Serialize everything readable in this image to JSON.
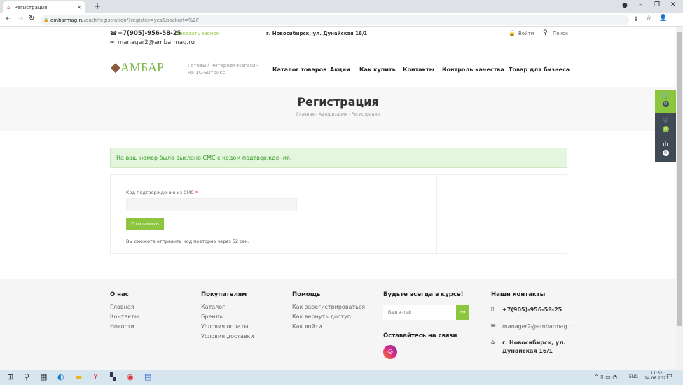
{
  "browser": {
    "tab_title": "Регистрация",
    "url_host": "ambarmag.ru",
    "url_path": "/auth/registration/?register=yes&backurl=%2F"
  },
  "topbar": {
    "phone": "+7(905)-956-58-25",
    "callback": "Заказать звонок",
    "email": "manager2@ambarmag.ru",
    "address": "г. Новосибирск, ул. Дунайская 16/1",
    "login": "Войти",
    "search": "Поиск"
  },
  "header": {
    "logo": "АМБАР",
    "slogan_1": "Готовый интернет-магазин",
    "slogan_2": "на 1С-Битрикс",
    "nav": [
      "Каталог товаров",
      "Акции",
      "Как купить",
      "Контакты",
      "Контроль качества",
      "Товар для бизнеса"
    ]
  },
  "page": {
    "title": "Регистрация",
    "breadcrumb": [
      "Главная",
      "Авторизация",
      "Регистрация"
    ],
    "alert": "На ваш номер было выслано СМС с кодом подтверждения.",
    "code_label": "Код подтверждения из СМС",
    "required_mark": "*",
    "code_value": "",
    "submit": "Отправить",
    "resend_note": "Вы сможете отправить код повторно через 52 сек."
  },
  "side": {
    "cart_count": "0",
    "favorites_count": "0",
    "compare_count": "0"
  },
  "footer": {
    "about": {
      "title": "О нас",
      "links": [
        "Главная",
        "Контакты",
        "Новости"
      ]
    },
    "buyers": {
      "title": "Покупателям",
      "links": [
        "Каталог",
        "Бренды",
        "Условия оплаты",
        "Условия доставки"
      ]
    },
    "help": {
      "title": "Помощь",
      "links": [
        "Как зарегистрироваться",
        "Как вернуть доступ",
        "Как войти"
      ]
    },
    "subscribe": {
      "title": "Будьте всегда в курсе!",
      "placeholder": "Ваш e-mail",
      "social_title": "Оставайтесь на связи"
    },
    "contacts": {
      "title": "Наши контакты",
      "phone": "+7(905)-956-58-25",
      "email": "manager2@ambarmag.ru",
      "address_1": "г. Новосибирск, ул.",
      "address_2": "Дунайская 16/1"
    }
  },
  "taskbar": {
    "lang": "ENG",
    "time": "11:32",
    "date": "24.08.2021"
  },
  "colors": {
    "accent": "#8cc63f",
    "dark": "#3f4a56"
  }
}
